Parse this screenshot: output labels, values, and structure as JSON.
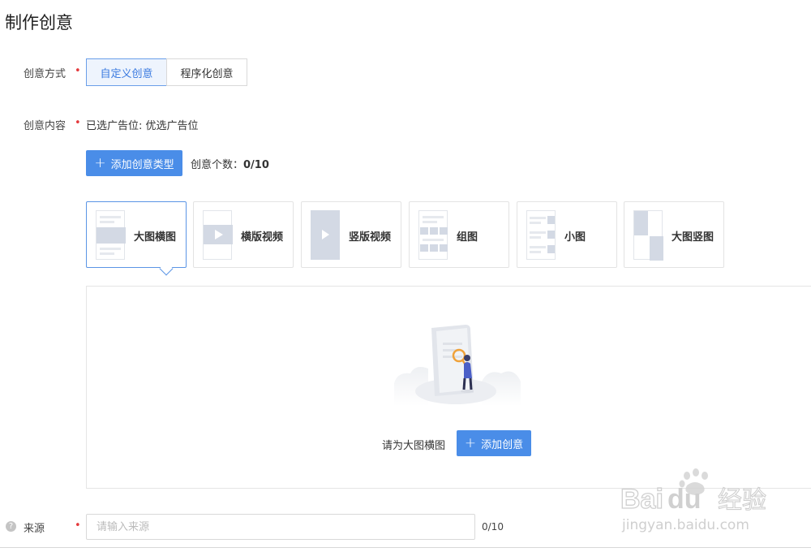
{
  "page": {
    "title": "制作创意"
  },
  "method": {
    "label": "创意方式",
    "required": "•",
    "options": [
      {
        "label": "自定义创意",
        "active": true
      },
      {
        "label": "程序化创意",
        "active": false
      }
    ]
  },
  "content": {
    "label": "创意内容",
    "required": "•",
    "selected_slots": "已选广告位: 优选广告位",
    "add_type_button": {
      "icon": "plus-icon",
      "label": "添加创意类型"
    },
    "count": {
      "label": "创意个数：",
      "value": "0/10"
    },
    "types": [
      {
        "label": "大图横图",
        "icon": "large-landscape-thumb",
        "active": true
      },
      {
        "label": "横版视频",
        "icon": "landscape-video-thumb",
        "active": false
      },
      {
        "label": "竖版视频",
        "icon": "portrait-video-thumb",
        "active": false
      },
      {
        "label": "组图",
        "icon": "group-images-thumb",
        "active": false
      },
      {
        "label": "小图",
        "icon": "small-image-thumb",
        "active": false
      },
      {
        "label": "大图竖图",
        "icon": "large-portrait-thumb",
        "active": false
      }
    ],
    "empty_state": {
      "illustration": "person-with-magnifier-illustration",
      "hint": "请为大图横图",
      "add_button": {
        "icon": "plus-icon",
        "label": "添加创意"
      }
    }
  },
  "source": {
    "label": "来源",
    "required": "•",
    "help_icon": "question-circle-icon",
    "placeholder": "请输入来源",
    "value": "",
    "count": "0/10"
  },
  "watermark": {
    "logo_text": "Baidu经验",
    "url": "jingyan.baidu.com"
  },
  "colors": {
    "accent": "#4a8de8",
    "active_border": "#5b95e5",
    "required": "#e4393c",
    "thumb_fill": "#d3d9e4"
  }
}
